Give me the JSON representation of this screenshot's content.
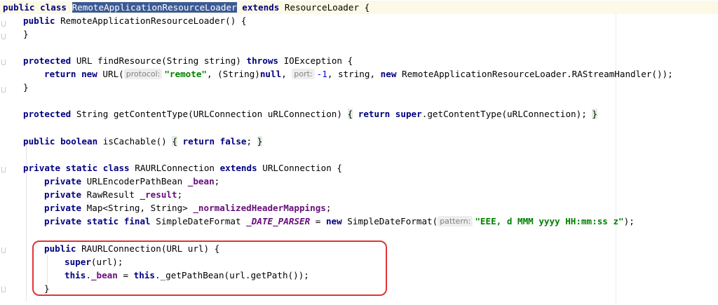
{
  "editor": {
    "lines": [
      {
        "t1": "public class",
        "t2": "RemoteApplicationResourceLoader",
        "t3": "extends",
        "t4": "ResourceLoader {"
      },
      {
        "t1": "public",
        "t2": "RemoteApplicationResourceLoader() {"
      },
      {
        "t1": "}"
      },
      {
        "t1": "protected",
        "t2": "URL findResource(String string)",
        "t3": "throws",
        "t4": "IOException {"
      },
      {
        "t1": "return new",
        "t2": "URL(",
        "hint1": "protocol:",
        "s1": "\"remote\"",
        "t3": ", (String)",
        "t4": "null",
        "t5": ",",
        "hint2": "port:",
        "n1": "-1",
        "t6": ", string,",
        "t7": "new",
        "t8": "RemoteApplicationResourceLoader.RAStreamHandler());"
      },
      {
        "t1": "}"
      },
      {
        "t1": "protected",
        "t2": "String getContentType(URLConnection uRLConnection)",
        "b1": "{",
        "t3": "return super",
        "t4": ".getContentType(uRLConnection);",
        "b2": "}"
      },
      {
        "t1": "public boolean",
        "t2": "isCachable()",
        "b1": "{",
        "t3": "return false",
        "t4": ";",
        "b2": "}"
      },
      {
        "t1": "private static class",
        "t2": "RAURLConnection",
        "t3": "extends",
        "t4": "URLConnection {"
      },
      {
        "t1": "private",
        "t2": "URLEncoderPathBean",
        "f1": "_bean",
        "t3": ";"
      },
      {
        "t1": "private",
        "t2": "RawResult",
        "f1": "_result",
        "t3": ";"
      },
      {
        "t1": "private",
        "t2": "Map<String, String>",
        "f1": "_normalizedHeaderMappings",
        "t3": ";"
      },
      {
        "t1": "private static final",
        "t2": "SimpleDateFormat",
        "f1": "_DATE_PARSER",
        "t3": "=",
        "t4": "new",
        "t5": "SimpleDateFormat(",
        "hint1": "pattern:",
        "s1": "\"EEE, d MMM yyyy HH:mm:ss z\"",
        "t6": ");"
      },
      {
        "t1": "public",
        "t2": "RAURLConnection(URL url) {"
      },
      {
        "t1": "super",
        "t2": "(url);"
      },
      {
        "t1": "this",
        "t2": ".",
        "f1": "_bean",
        "t3": "=",
        "t4": "this",
        "t5": "._getPathBean(url.getPath());"
      },
      {
        "t1": "}"
      }
    ]
  },
  "colors": {
    "keyword": "#000080",
    "string": "#008000",
    "number": "#0000ff",
    "field": "#660e7a",
    "highlight_box": "#e03434",
    "current_line": "#fcfae6"
  }
}
